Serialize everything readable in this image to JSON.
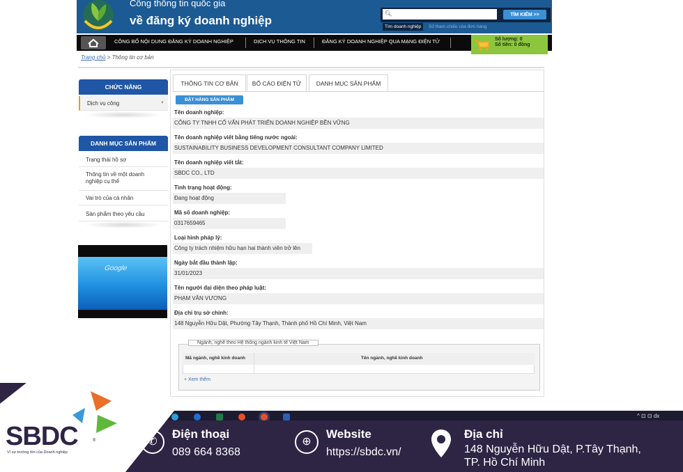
{
  "header": {
    "portal_small": "Cổng thông tin quốc gia",
    "portal_big": "về đăng ký doanh nghiệp",
    "search_placeholder": "",
    "search_button": "TÌM KIẾM >>",
    "search_tab_active": "Tìm doanh nghiệp",
    "search_tab_other": "Số tham chiếu của đơn hàng"
  },
  "nav": {
    "items": [
      "CÔNG BỐ NỘI DUNG ĐĂNG KÝ DOANH NGHIỆP",
      "DỊCH VỤ THÔNG TIN",
      "ĐĂNG KÝ DOANH NGHIỆP QUA MẠNG ĐIỆN TỬ"
    ],
    "cart_qty": "Số lượng: 0",
    "cart_amount": "Số tiền: 0 đồng"
  },
  "breadcrumb": {
    "home": "Trang chủ",
    "sep": " > ",
    "current": "Thông tin cơ bản"
  },
  "sidebar": {
    "chuc_nang": "CHỨC NĂNG",
    "dich_vu": "Dịch vụ công",
    "danh_muc": "DANH MỤC SẢN PHẨM",
    "items": [
      "Trạng thái hồ sơ",
      "Thông tin về một doanh nghiệp cụ thể",
      "Vai trò của cá nhân",
      "Sản phẩm theo yêu cầu"
    ],
    "banner_word": "Google"
  },
  "tabs": [
    "THÔNG TIN CƠ BẢN",
    "BỐ CÁO ĐIỆN TỬ",
    "DANH MỤC SẢN PHẨM"
  ],
  "order_button": "ĐẶT HÀNG SẢN PHẨM",
  "fields": [
    {
      "label": "Tên doanh nghiệp:",
      "value": "CÔNG TY TNHH CỐ VẤN PHÁT TRIỂN DOANH NGHIỆP BỀN VỮNG"
    },
    {
      "label": "Tên doanh nghiệp viết bằng tiếng nước ngoài:",
      "value": "SUSTAINABILITY BUSINESS DEVELOPMENT CONSULTANT COMPANY LIMITED"
    },
    {
      "label": "Tên doanh nghiệp viết tắt:",
      "value": "SBDC CO., LTD"
    },
    {
      "label": "Tình trạng hoạt động:",
      "value": "Đang hoạt động"
    },
    {
      "label": "Mã số doanh nghiệp:",
      "value": "0317659465"
    },
    {
      "label": "Loại hình pháp lý:",
      "value": "Công ty trách nhiệm hữu hạn hai thành viên trở lên"
    },
    {
      "label": "Ngày bắt đầu thành lập:",
      "value": "31/01/2023"
    },
    {
      "label": "Tên người đại diện theo pháp luật:",
      "value": "PHẠM VĂN VƯƠNG"
    },
    {
      "label": "Địa chỉ trụ sở chính:",
      "value": "148 Nguyễn Hữu Dật, Phường Tây Thạnh, Thành phố Hồ Chí Minh, Việt Nam"
    }
  ],
  "industry": {
    "legend": "Ngành, nghề theo Hệ thống ngành kinh tế Việt Nam",
    "col1": "Mã ngành, nghề kinh doanh",
    "col2": "Tên ngành, nghề kinh doanh",
    "see_more": "+ Xem thêm"
  },
  "taskbar": {
    "tray": "^ ⊡ ⊡ dx"
  },
  "footer": {
    "brand": "SBDC",
    "reg": "®",
    "slogan": "Vì sự trường tồn của Doanh nghiệp",
    "phone_title": "Điện thoại",
    "phone_value": "089 664 8368",
    "web_title": "Website",
    "web_value": "https://sbdc.vn/",
    "addr_title": "Địa chỉ",
    "addr_line1": "148 Nguyễn Hữu Dật, P.Tây Thạnh,",
    "addr_line2": "TP. Hồ Chí Minh"
  },
  "colors": {
    "header_blue": "#1c5a93",
    "tab_blue": "#1f56a5",
    "cart_green": "#8cc63f",
    "footer_purple": "#2e2545",
    "accent_orange": "#e8702a"
  }
}
